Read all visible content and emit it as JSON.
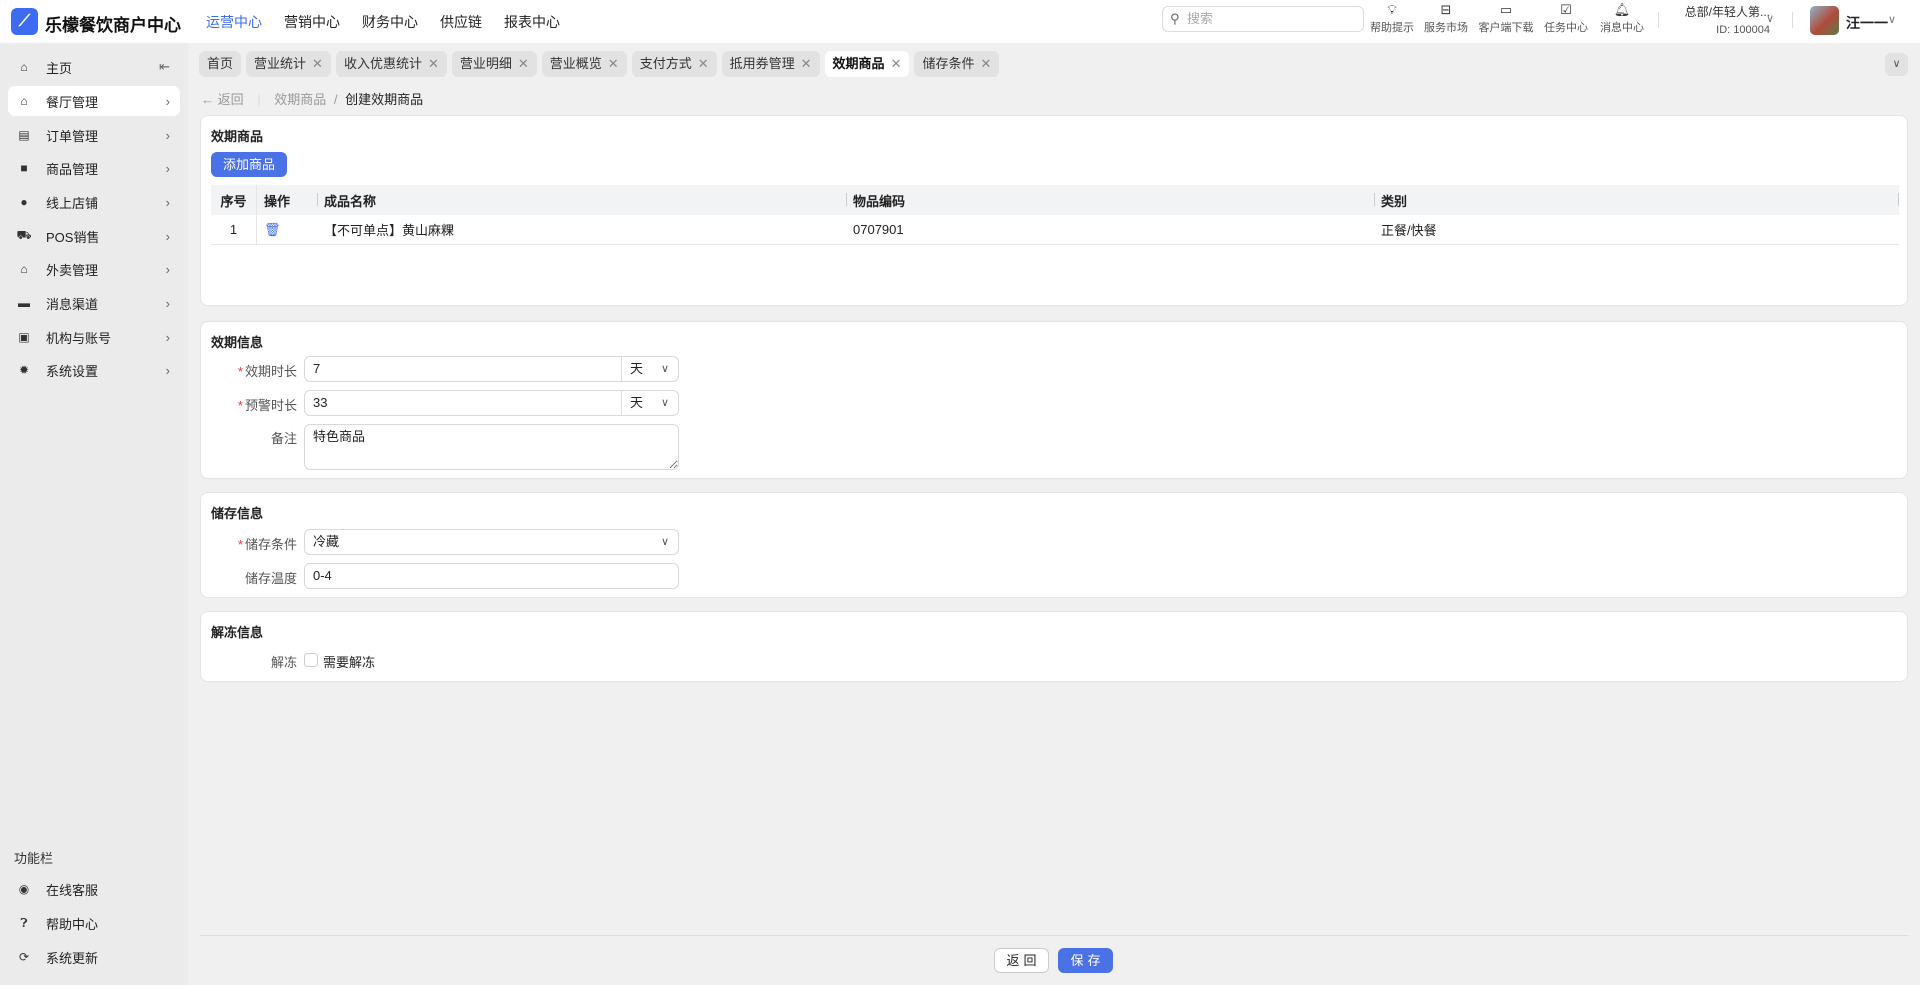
{
  "header": {
    "brand": "乐檬餐饮商户中心",
    "nav": [
      "运营中心",
      "营销中心",
      "财务中心",
      "供应链",
      "报表中心"
    ],
    "active_nav": 0,
    "search_placeholder": "搜索",
    "tools": [
      {
        "icon": "lightbulb-icon",
        "label": "帮助提示"
      },
      {
        "icon": "bag-icon",
        "label": "服务市场"
      },
      {
        "icon": "folder-download-icon",
        "label": "客户端下载"
      },
      {
        "icon": "clipboard-check-icon",
        "label": "任务中心"
      },
      {
        "icon": "bell-icon",
        "label": "消息中心"
      }
    ],
    "org_name": "总部/年轻人第...",
    "org_id": "ID: 100004",
    "user": "汪一一"
  },
  "sidebar": {
    "items": [
      {
        "label": "主页",
        "icon": "home-icon"
      },
      {
        "label": "餐厅管理",
        "icon": "store-icon"
      },
      {
        "label": "订单管理",
        "icon": "order-icon"
      },
      {
        "label": "商品管理",
        "icon": "goods-icon"
      },
      {
        "label": "线上店铺",
        "icon": "globe-icon"
      },
      {
        "label": "POS销售",
        "icon": "cart-icon"
      },
      {
        "label": "外卖管理",
        "icon": "bank-icon"
      },
      {
        "label": "消息渠道",
        "icon": "chat-icon"
      },
      {
        "label": "机构与账号",
        "icon": "id-card-icon"
      },
      {
        "label": "系统设置",
        "icon": "gear-icon"
      }
    ],
    "func_title": "功能栏",
    "func_items": [
      {
        "label": "在线客服",
        "icon": "headset-icon"
      },
      {
        "label": "帮助中心",
        "icon": "help-icon"
      },
      {
        "label": "系统更新",
        "icon": "refresh-icon"
      }
    ]
  },
  "tabs": [
    {
      "label": "首页"
    },
    {
      "label": "营业统计"
    },
    {
      "label": "收入优惠统计"
    },
    {
      "label": "营业明细"
    },
    {
      "label": "营业概览"
    },
    {
      "label": "支付方式"
    },
    {
      "label": "抵用券管理"
    },
    {
      "label": "效期商品"
    },
    {
      "label": "储存条件"
    }
  ],
  "breadcrumb": {
    "back": "返回",
    "parent": "效期商品",
    "sep": "/",
    "current": "创建效期商品"
  },
  "goods": {
    "title": "效期商品",
    "add_button": "添加商品",
    "columns": [
      "序号",
      "操作",
      "成品名称",
      "物品编码",
      "类别"
    ],
    "rows": [
      {
        "index": "1",
        "name": "【不可单点】黄山麻粿",
        "code": "0707901",
        "category": "正餐/快餐"
      }
    ]
  },
  "expiry": {
    "title": "效期信息",
    "duration_label": "效期时长",
    "duration_value": "7",
    "duration_unit": "天",
    "warn_label": "预警时长",
    "warn_value": "33",
    "warn_unit": "天",
    "note_label": "备注",
    "note_value": "特色商品"
  },
  "storage": {
    "title": "储存信息",
    "cond_label": "储存条件",
    "cond_value": "冷藏",
    "temp_label": "储存温度",
    "temp_value": "0-4"
  },
  "thaw": {
    "title": "解冻信息",
    "label": "解冻",
    "checkbox_label": "需要解冻",
    "checked": false
  },
  "footer": {
    "back": "返回",
    "save": "保存"
  },
  "colors": {
    "accent": "#4a72e6"
  }
}
